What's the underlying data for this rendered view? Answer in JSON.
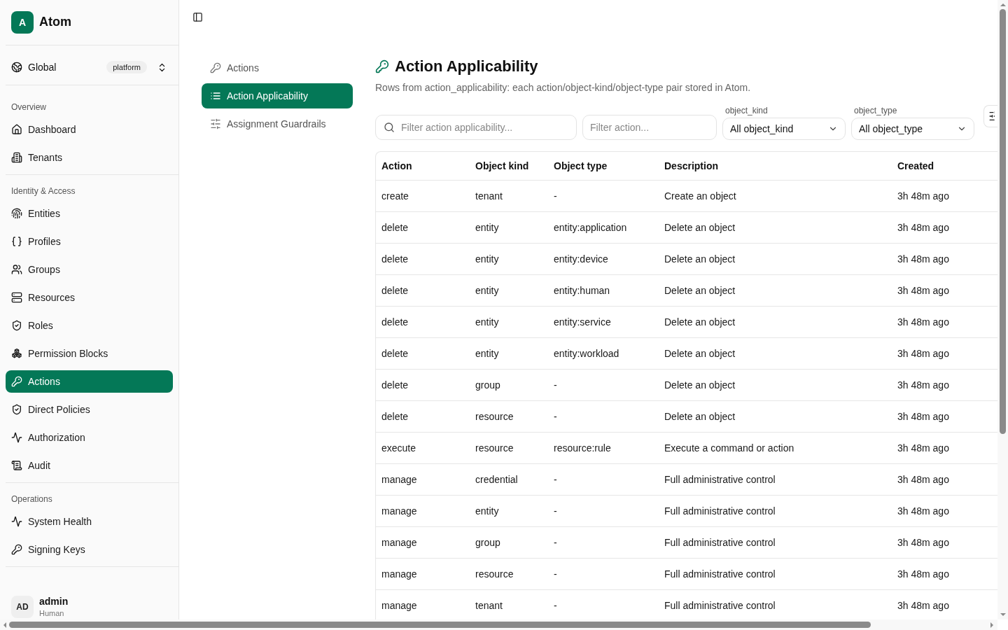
{
  "brand": {
    "logo_letter": "A",
    "name": "Atom"
  },
  "scope": {
    "label": "Global",
    "badge": "platform"
  },
  "sidebar": {
    "sections": [
      {
        "title": "Overview",
        "items": [
          {
            "label": "Dashboard",
            "selected": false
          },
          {
            "label": "Tenants",
            "selected": false
          }
        ]
      },
      {
        "title": "Identity & Access",
        "items": [
          {
            "label": "Entities",
            "selected": false
          },
          {
            "label": "Profiles",
            "selected": false
          },
          {
            "label": "Groups",
            "selected": false
          },
          {
            "label": "Resources",
            "selected": false
          },
          {
            "label": "Roles",
            "selected": false
          },
          {
            "label": "Permission Blocks",
            "selected": false
          },
          {
            "label": "Actions",
            "selected": true
          },
          {
            "label": "Direct Policies",
            "selected": false
          },
          {
            "label": "Authorization",
            "selected": false
          },
          {
            "label": "Audit",
            "selected": false
          }
        ]
      },
      {
        "title": "Operations",
        "items": [
          {
            "label": "System Health",
            "selected": false
          },
          {
            "label": "Signing Keys",
            "selected": false
          }
        ]
      }
    ]
  },
  "user": {
    "initials": "AD",
    "name": "admin",
    "role": "Human"
  },
  "subnav": [
    {
      "label": "Actions",
      "selected": false
    },
    {
      "label": "Action Applicability",
      "selected": true
    },
    {
      "label": "Assignment Guardrails",
      "selected": false
    }
  ],
  "page": {
    "title": "Action Applicability",
    "subtitle": "Rows from action_applicability: each action/object-kind/object-type pair stored in Atom."
  },
  "filters": {
    "search": {
      "placeholder": "Filter action applicability..."
    },
    "action": {
      "placeholder": "Filter action..."
    },
    "selects": [
      {
        "label": "object_kind",
        "value": "All object_kind"
      },
      {
        "label": "object_type",
        "value": "All object_type"
      }
    ]
  },
  "table": {
    "columns": [
      "Action",
      "Object kind",
      "Object type",
      "Description",
      "Created"
    ],
    "rows": [
      [
        "create",
        "tenant",
        "-",
        "Create an object",
        "3h 48m ago"
      ],
      [
        "delete",
        "entity",
        "entity:application",
        "Delete an object",
        "3h 48m ago"
      ],
      [
        "delete",
        "entity",
        "entity:device",
        "Delete an object",
        "3h 48m ago"
      ],
      [
        "delete",
        "entity",
        "entity:human",
        "Delete an object",
        "3h 48m ago"
      ],
      [
        "delete",
        "entity",
        "entity:service",
        "Delete an object",
        "3h 48m ago"
      ],
      [
        "delete",
        "entity",
        "entity:workload",
        "Delete an object",
        "3h 48m ago"
      ],
      [
        "delete",
        "group",
        "-",
        "Delete an object",
        "3h 48m ago"
      ],
      [
        "delete",
        "resource",
        "-",
        "Delete an object",
        "3h 48m ago"
      ],
      [
        "execute",
        "resource",
        "resource:rule",
        "Execute a command or action",
        "3h 48m ago"
      ],
      [
        "manage",
        "credential",
        "-",
        "Full administrative control",
        "3h 48m ago"
      ],
      [
        "manage",
        "entity",
        "-",
        "Full administrative control",
        "3h 48m ago"
      ],
      [
        "manage",
        "group",
        "-",
        "Full administrative control",
        "3h 48m ago"
      ],
      [
        "manage",
        "resource",
        "-",
        "Full administrative control",
        "3h 48m ago"
      ],
      [
        "manage",
        "tenant",
        "-",
        "Full administrative control",
        "3h 48m ago"
      ]
    ]
  }
}
